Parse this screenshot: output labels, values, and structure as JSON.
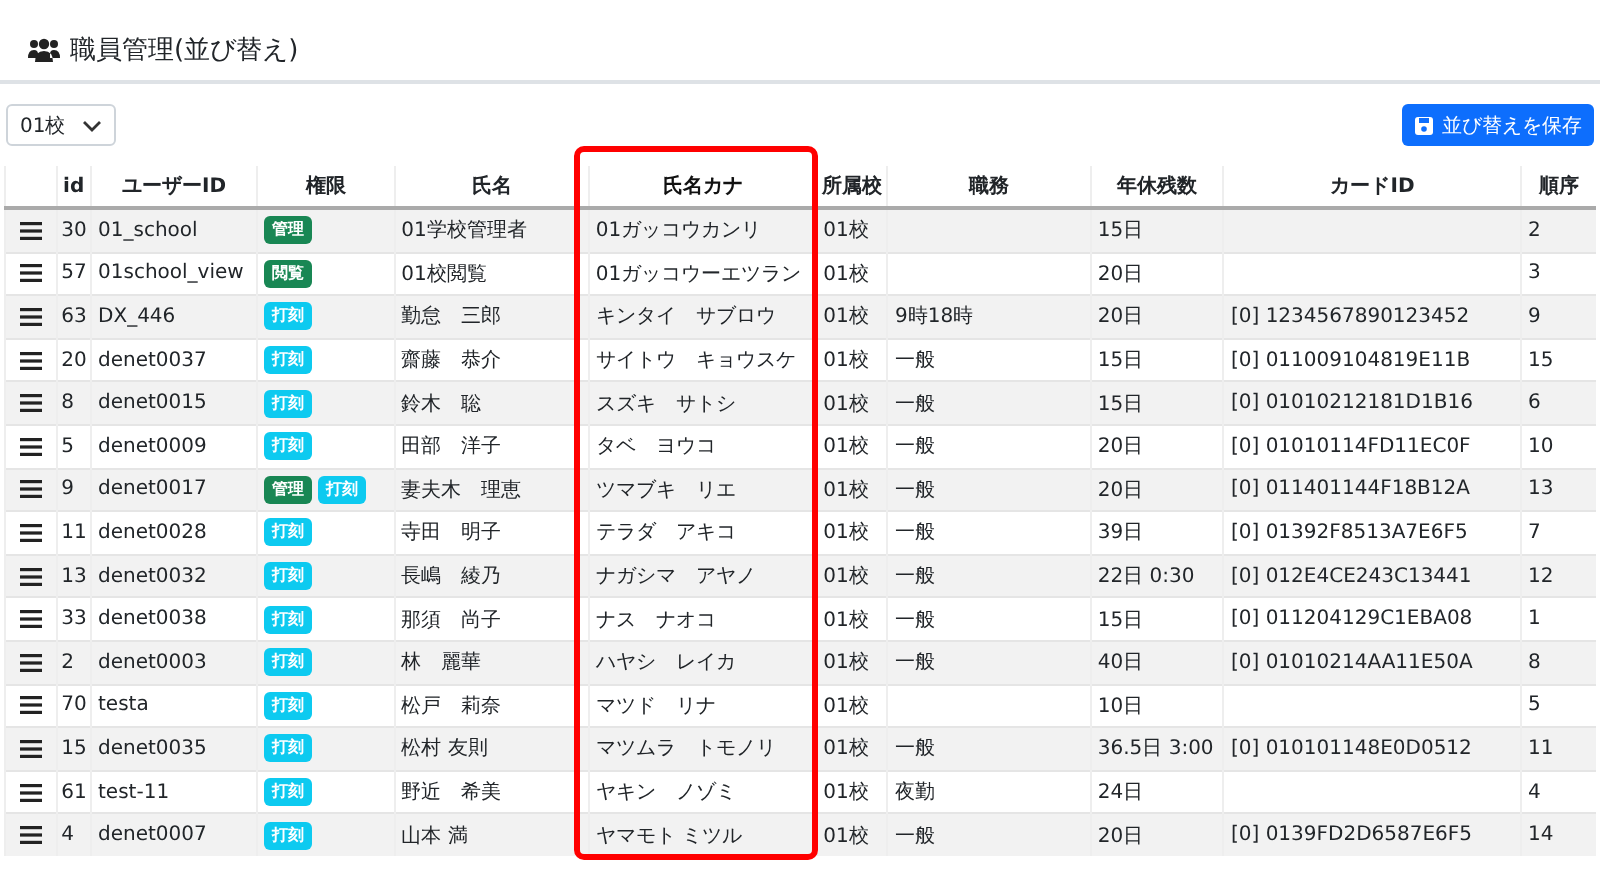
{
  "page": {
    "title": "職員管理(並び替え)"
  },
  "toolbar": {
    "school_select": "01校",
    "save_button": "並び替えを保存"
  },
  "table": {
    "columns": [
      {
        "highlighted": false
      },
      {
        "label": "id",
        "highlighted": false
      },
      {
        "label": "ユーザーID",
        "highlighted": false
      },
      {
        "label": "権限",
        "highlighted": false
      },
      {
        "label": "氏名",
        "highlighted": false
      },
      {
        "label": "氏名カナ",
        "highlighted": true
      },
      {
        "label": "所属校",
        "highlighted": false
      },
      {
        "label": "職務",
        "highlighted": false
      },
      {
        "label": "年休残数",
        "highlighted": false
      },
      {
        "label": "カードID",
        "highlighted": false
      },
      {
        "label": "順序",
        "highlighted": false
      }
    ],
    "rows": [
      {
        "id": "30",
        "user_id": "01_school",
        "roles": [
          {
            "kind": "admin",
            "label": "管理"
          }
        ],
        "name": "01学校管理者",
        "kana": "01ガッコウカンリ",
        "school": "01校",
        "duty": "",
        "leave": "15日",
        "card_id": "",
        "order": "2"
      },
      {
        "id": "57",
        "user_id": "01school_view",
        "roles": [
          {
            "kind": "view",
            "label": "閲覧"
          }
        ],
        "name": "01校閲覧",
        "kana": "01ガッコウーエツラン",
        "school": "01校",
        "duty": "",
        "leave": "20日",
        "card_id": "",
        "order": "3"
      },
      {
        "id": "63",
        "user_id": "DX_446",
        "roles": [
          {
            "kind": "stamp",
            "label": "打刻"
          }
        ],
        "name": "勤怠　三郎",
        "kana": "キンタイ　サブロウ",
        "school": "01校",
        "duty": "9時18時",
        "leave": "20日",
        "card_id": "[0] 1234567890123452",
        "order": "9"
      },
      {
        "id": "20",
        "user_id": "denet0037",
        "roles": [
          {
            "kind": "stamp",
            "label": "打刻"
          }
        ],
        "name": "齋藤　恭介",
        "kana": "サイトウ　キョウスケ",
        "school": "01校",
        "duty": "一般",
        "leave": "15日",
        "card_id": "[0] 011009104819E11B",
        "order": "15"
      },
      {
        "id": "8",
        "user_id": "denet0015",
        "roles": [
          {
            "kind": "stamp",
            "label": "打刻"
          }
        ],
        "name": "鈴木　聡",
        "kana": "スズキ　サトシ",
        "school": "01校",
        "duty": "一般",
        "leave": "15日",
        "card_id": "[0] 01010212181D1B16",
        "order": "6"
      },
      {
        "id": "5",
        "user_id": "denet0009",
        "roles": [
          {
            "kind": "stamp",
            "label": "打刻"
          }
        ],
        "name": "田部　洋子",
        "kana": "タベ　ヨウコ",
        "school": "01校",
        "duty": "一般",
        "leave": "20日",
        "card_id": "[0] 01010114FD11EC0F",
        "order": "10"
      },
      {
        "id": "9",
        "user_id": "denet0017",
        "roles": [
          {
            "kind": "admin",
            "label": "管理"
          },
          {
            "kind": "stamp",
            "label": "打刻"
          }
        ],
        "name": "妻夫木　理恵",
        "kana": "ツマブキ　リエ",
        "school": "01校",
        "duty": "一般",
        "leave": "20日",
        "card_id": "[0] 011401144F18B12A",
        "order": "13"
      },
      {
        "id": "11",
        "user_id": "denet0028",
        "roles": [
          {
            "kind": "stamp",
            "label": "打刻"
          }
        ],
        "name": "寺田　明子",
        "kana": "テラダ　アキコ",
        "school": "01校",
        "duty": "一般",
        "leave": "39日",
        "card_id": "[0] 01392F8513A7E6F5",
        "order": "7"
      },
      {
        "id": "13",
        "user_id": "denet0032",
        "roles": [
          {
            "kind": "stamp",
            "label": "打刻"
          }
        ],
        "name": "長嶋　綾乃",
        "kana": "ナガシマ　アヤノ",
        "school": "01校",
        "duty": "一般",
        "leave": "22日 0:30",
        "card_id": "[0] 012E4CE243C13441",
        "order": "12"
      },
      {
        "id": "33",
        "user_id": "denet0038",
        "roles": [
          {
            "kind": "stamp",
            "label": "打刻"
          }
        ],
        "name": "那須　尚子",
        "kana": "ナス　ナオコ",
        "school": "01校",
        "duty": "一般",
        "leave": "15日",
        "card_id": "[0] 011204129C1EBA08",
        "order": "1"
      },
      {
        "id": "2",
        "user_id": "denet0003",
        "roles": [
          {
            "kind": "stamp",
            "label": "打刻"
          }
        ],
        "name": "林　麗華",
        "kana": "ハヤシ　レイカ",
        "school": "01校",
        "duty": "一般",
        "leave": "40日",
        "card_id": "[0] 01010214AA11E50A",
        "order": "8"
      },
      {
        "id": "70",
        "user_id": "testa",
        "roles": [
          {
            "kind": "stamp",
            "label": "打刻"
          }
        ],
        "name": "松戸　莉奈",
        "kana": "マツド　リナ",
        "school": "01校",
        "duty": "",
        "leave": "10日",
        "card_id": "",
        "order": "5"
      },
      {
        "id": "15",
        "user_id": "denet0035",
        "roles": [
          {
            "kind": "stamp",
            "label": "打刻"
          }
        ],
        "name": "松村 友則",
        "kana": "マツムラ　トモノリ",
        "school": "01校",
        "duty": "一般",
        "leave": "36.5日 3:00",
        "card_id": "[0] 010101148E0D0512",
        "order": "11"
      },
      {
        "id": "61",
        "user_id": "test-11",
        "roles": [
          {
            "kind": "stamp",
            "label": "打刻"
          }
        ],
        "name": "野近　希美",
        "kana": "ヤキン　ノゾミ",
        "school": "01校",
        "duty": "夜勤",
        "leave": "24日",
        "card_id": "",
        "order": "4"
      },
      {
        "id": "4",
        "user_id": "denet0007",
        "roles": [
          {
            "kind": "stamp",
            "label": "打刻"
          }
        ],
        "name": "山本 満",
        "kana": "ヤマモト ミツル",
        "school": "01校",
        "duty": "一般",
        "leave": "20日",
        "card_id": "[0] 0139FD2D6587E6F5",
        "order": "14"
      }
    ]
  }
}
